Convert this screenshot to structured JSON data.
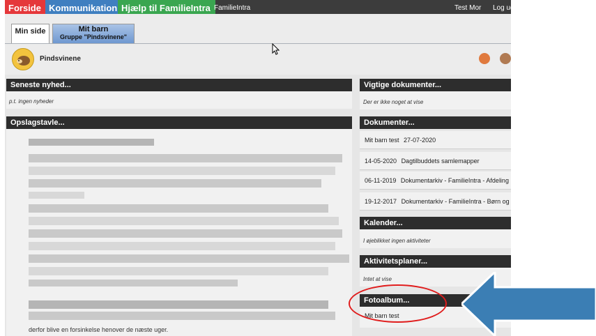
{
  "topnav": {
    "items": [
      "Forside",
      "Kommunikation",
      "Hjælp til FamilieIntra"
    ],
    "app_name": "FamilieIntra",
    "user": "Test Mor",
    "logout": "Log ud"
  },
  "tabs": [
    {
      "label": "Min side",
      "sub": ""
    },
    {
      "label": "Mit barn",
      "sub": "Gruppe \"Pindsvinene\""
    }
  ],
  "group": {
    "name": "Pindsvinene",
    "avatar_icon": "hedgehog-icon"
  },
  "panels": {
    "news": {
      "title": "Seneste nyhed...",
      "body": "p.t. ingen nyheder"
    },
    "board": {
      "title": "Opslagstavle...",
      "footer_fragment": "derfor blive en forsinkelse henover de næste uger."
    },
    "important": {
      "title": "Vigtige dokumenter...",
      "body": "Der er ikke noget at vise"
    },
    "documents": {
      "title": "Dokumenter...",
      "rows": [
        {
          "name": "Mit barn test",
          "date": "27-07-2020"
        },
        {
          "date": "14-05-2020",
          "name": "Dagtilbuddets samlemapper"
        },
        {
          "date": "06-11-2019",
          "name": "Dokumentarkiv - FamilieIntra - Afdeling"
        },
        {
          "date": "19-12-2017",
          "name": "Dokumentarkiv - FamilieIntra - Børn og"
        }
      ]
    },
    "calendar": {
      "title": "Kalender...",
      "body": "I øjeblikket ingen aktiviteter"
    },
    "plans": {
      "title": "Aktivitetsplaner...",
      "body": "Intet at vise"
    },
    "photos": {
      "title": "Fotoalbum...",
      "item": "Mit barn test"
    }
  },
  "annotation": {
    "ellipse_color": "#e01c1c",
    "arrow_color": "#3b7eb4"
  }
}
